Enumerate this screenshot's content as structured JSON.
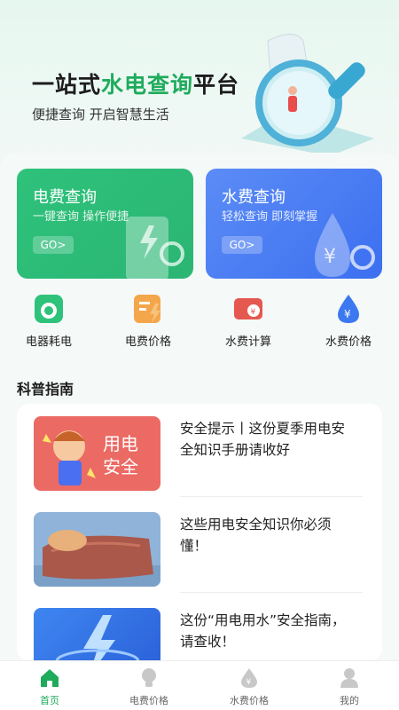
{
  "hero": {
    "title_prefix": "一站式",
    "title_highlight": "水电查询",
    "title_suffix": "平台",
    "subtitle": "便捷查询 开启智慧生活"
  },
  "cards": [
    {
      "title": "电费查询",
      "subtitle": "一键查询 操作便捷",
      "button": "GO>"
    },
    {
      "title": "水费查询",
      "subtitle": "轻松查询 即刻掌握",
      "button": "GO>"
    }
  ],
  "quick_actions": [
    {
      "label": "电器耗电",
      "icon": "appliance-icon"
    },
    {
      "label": "电费价格",
      "icon": "electricity-price-icon"
    },
    {
      "label": "水费计算",
      "icon": "water-bill-icon"
    },
    {
      "label": "水费价格",
      "icon": "water-price-icon"
    }
  ],
  "section": {
    "title": "科普指南"
  },
  "articles": [
    {
      "text": "安全提示丨这份夏季用电安全知识手册请收好",
      "thumb_text": [
        "用电",
        "安全"
      ]
    },
    {
      "text": "这些用电安全知识你必须懂！"
    },
    {
      "text": "这份“用电用水”安全指南，请查收！"
    }
  ],
  "tabs": [
    {
      "label": "首页",
      "icon": "home-icon",
      "active": true
    },
    {
      "label": "电费价格",
      "icon": "bulb-icon"
    },
    {
      "label": "水费价格",
      "icon": "water-drop-icon"
    },
    {
      "label": "我的",
      "icon": "user-icon"
    }
  ],
  "colors": {
    "accent": "#1fab5c",
    "electric_card": "#2ec27b",
    "water_card": "#4a7df3"
  }
}
